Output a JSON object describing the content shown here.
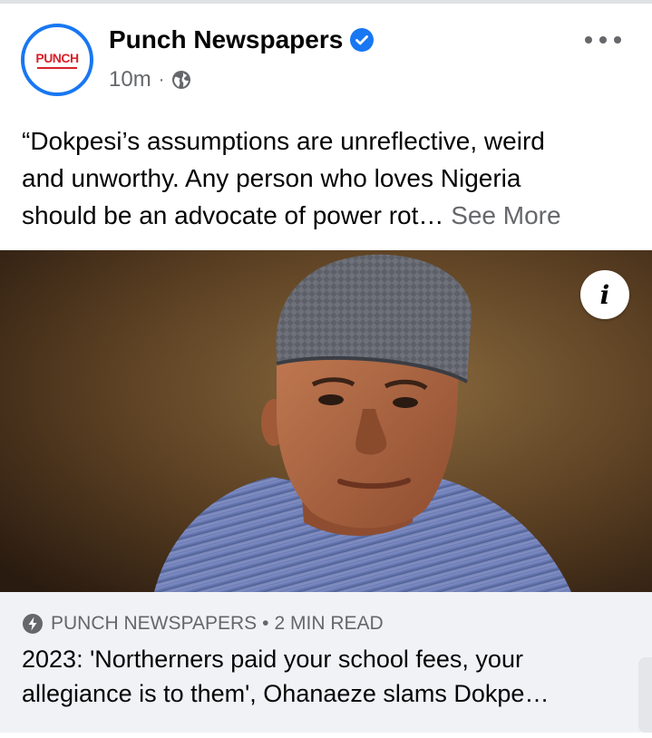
{
  "post": {
    "page_name": "Punch Newspapers",
    "avatar_text": "PUNCH",
    "time": "10m",
    "separator": "·",
    "text_line1": "“Dokpesi’s assumptions are unreflective, weird",
    "text_line2": "and unworthy. Any person who loves Nigeria",
    "text_line3": "should be an advocate of power rot…",
    "see_more": "See More",
    "icons": {
      "verified": "verified-badge-icon",
      "audience": "globe-icon",
      "menu": "more-options-icon",
      "info": "info-icon",
      "link_source": "lightning-bolt-icon"
    }
  },
  "image": {
    "info_glyph": "i"
  },
  "link": {
    "source": "PUNCH NEWSPAPERS",
    "dot": "•",
    "read_time": "2 MIN READ",
    "title_line1": "2023: 'Northerners paid your school fees, your",
    "title_line2": "allegiance is to them', Ohanaeze slams Dokpe…"
  },
  "colors": {
    "accent": "#1877f2",
    "brand_red": "#d8232a",
    "secondary_text": "#65676b",
    "link_bar_bg": "#f0f2f5"
  }
}
